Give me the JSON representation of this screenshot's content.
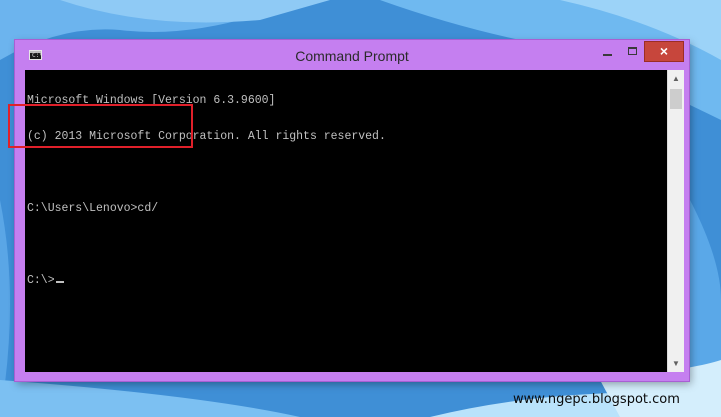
{
  "window": {
    "title": "Command Prompt",
    "icon": "cmd-icon",
    "icon_text": "C:\\",
    "controls": {
      "minimize": "minimize-icon",
      "maximize": "maximize-icon",
      "close": "×"
    }
  },
  "console": {
    "lines": [
      "Microsoft Windows [Version 6.3.9600]",
      "(c) 2013 Microsoft Corporation. All rights reserved.",
      "",
      "C:\\Users\\Lenovo>cd/",
      "",
      "C:\\>"
    ],
    "text_color": "#c0c0c0",
    "background": "#000000"
  },
  "highlight_color": "#e0202a",
  "watermark": "www.ngepc.blogspot.com"
}
